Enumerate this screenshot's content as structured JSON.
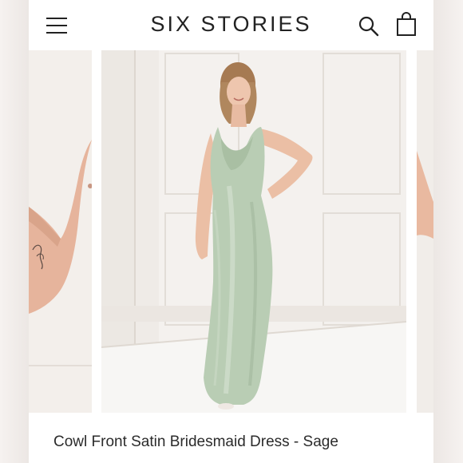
{
  "header": {
    "brand": "SIX STORIES",
    "menu_icon": "hamburger-menu-icon",
    "search_icon": "search-icon",
    "bag_icon": "shopping-bag-icon"
  },
  "gallery": {
    "slides": [
      "previous-product-photo",
      "current-product-photo",
      "next-product-photo"
    ],
    "dress_color": "#b9cdb4",
    "wall_color": "#f2efec"
  },
  "product": {
    "title": "Cowl Front Satin Bridesmaid Dress - Sage"
  },
  "colors": {
    "text": "#222222",
    "background": "#ffffff"
  }
}
